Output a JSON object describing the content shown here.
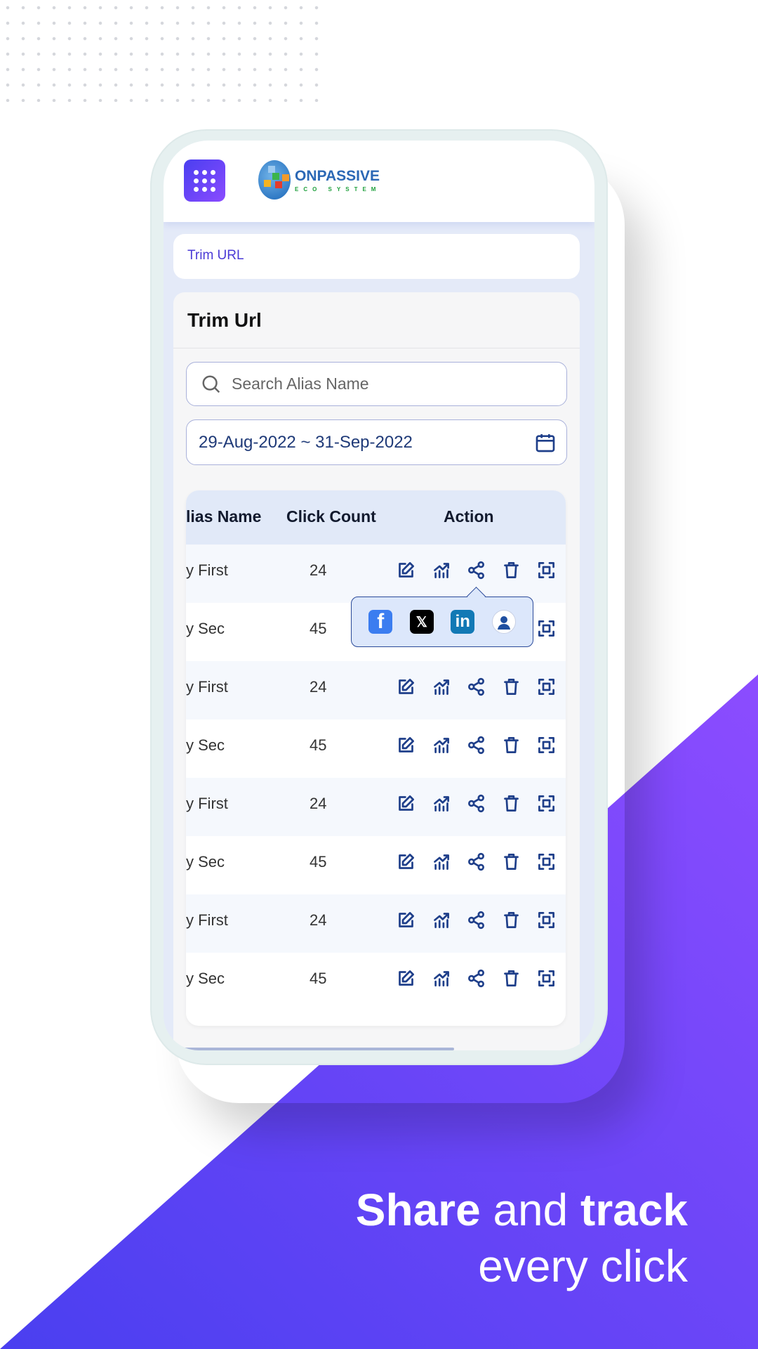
{
  "colors": {
    "accent": "#5b3ff2",
    "purple_light": "#8a4bff",
    "link": "#4a3ad6",
    "icon": "#1f3f8a"
  },
  "header": {
    "menu_icon": "grid-icon",
    "logo": {
      "name": "ONPASSIVE",
      "sub": "ECO SYSTEM"
    }
  },
  "breadcrumb": "Trim URL",
  "card": {
    "title": "Trim Url",
    "search": {
      "placeholder": "Search Alias Name",
      "value": ""
    },
    "date_range": "29-Aug-2022 ~ 31-Sep-2022",
    "table": {
      "headers": [
        "lias Name",
        "Click Count",
        "Action"
      ],
      "rows": [
        {
          "alias": "y First",
          "count": "24"
        },
        {
          "alias": "y Sec",
          "count": "45"
        },
        {
          "alias": "y First",
          "count": "24"
        },
        {
          "alias": "y Sec",
          "count": "45"
        },
        {
          "alias": "y First",
          "count": "24"
        },
        {
          "alias": "y Sec",
          "count": "45"
        },
        {
          "alias": "y First",
          "count": "24"
        },
        {
          "alias": "y Sec",
          "count": "45"
        }
      ],
      "actions": [
        "edit-icon",
        "analytics-icon",
        "share-icon",
        "delete-icon",
        "qr-scan-icon"
      ]
    },
    "share_popup": [
      "facebook",
      "x",
      "linkedin",
      "onpassive-connect"
    ]
  },
  "tagline": {
    "bold1": "Share",
    "mid": " and ",
    "bold2": "track",
    "line2": "every click"
  }
}
